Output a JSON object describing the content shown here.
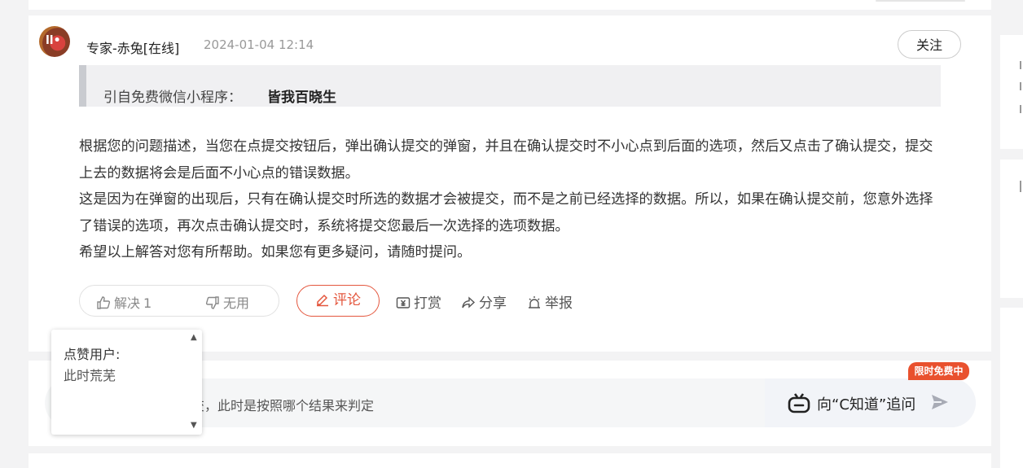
{
  "answer_card": {
    "author": "专家-赤兔[在线]",
    "timestamp": "2024-01-04 12:14",
    "follow_label": "关注",
    "quote_prefix": "引自免费微信小程序：",
    "quote_name": "皆我百晓生",
    "paragraphs": [
      "根据您的问题描述，当您在点提交按钮后，弹出确认提交的弹窗，并且在确认提交时不小心点到后面的选项，然后又点击了确认提交，提交上去的数据将会是后面不小心点的错误数据。",
      "这是因为在弹窗的出现后，只有在确认提交时所选的数据才会被提交，而不是之前已经选择的数据。所以，如果在确认提交前，您意外选择了错误的选项，再次点击确认提交时，系统将提交您最后一次选择的选项数据。",
      "希望以上解答对您有所帮助。如果您有更多疑问，请随时提问。"
    ]
  },
  "actions": {
    "like_label": "解决",
    "like_count": "1",
    "dislike_label": "无用",
    "comment_label": "评论",
    "reward_label": "打赏",
    "share_label": "分享",
    "report_label": "举报"
  },
  "likes_popup": {
    "title": "点赞用户:",
    "user": "此时荒芜"
  },
  "ask_bar": {
    "question_text": "交，此时是按照哪个结果来判定",
    "zhidao_label": "向“C知道”追问",
    "free_tag": "限时免费中"
  },
  "colors": {
    "accent": "#e4573e",
    "tag_bg": "#e9512e"
  }
}
